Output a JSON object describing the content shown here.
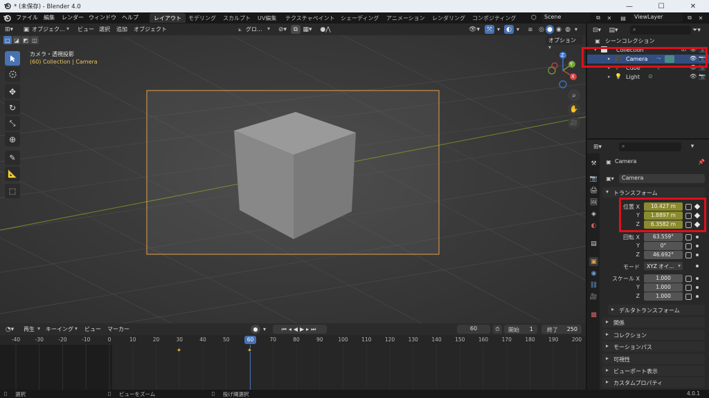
{
  "window": {
    "title": "* (未保存) - Blender 4.0"
  },
  "menubar": {
    "items": [
      "ファイル",
      "編集",
      "レンダー",
      "ウィンドウ",
      "ヘルプ"
    ],
    "workspaces": [
      "レイアウト",
      "モデリング",
      "スカルプト",
      "UV編集",
      "テクスチャペイント",
      "シェーディング",
      "アニメーション",
      "レンダリング",
      "コンポジティング"
    ],
    "active_workspace": "レイアウト",
    "scene": "Scene",
    "view_layer": "ViewLayer"
  },
  "viewport": {
    "header": {
      "mode": "オブジェク...",
      "view": "ビュー",
      "select": "選択",
      "add": "追加",
      "object": "オブジェクト",
      "transform_orientation": "グロ...",
      "options": "オプション"
    },
    "overlay_title": "カメラ・透視投影",
    "overlay_context": "(60) Collection | Camera",
    "gizmo_axes": [
      "X",
      "Y",
      "Z"
    ]
  },
  "timeline": {
    "header": {
      "playback": "再生",
      "keying": "キーイング",
      "view": "ビュー",
      "marker": "マーカー"
    },
    "current_frame": "60",
    "start_label": "開始",
    "start": "1",
    "end_label": "終了",
    "end": "250",
    "ruler": [
      "-40",
      "-30",
      "-20",
      "-10",
      "0",
      "10",
      "20",
      "30",
      "40",
      "50",
      "60",
      "70",
      "80",
      "90",
      "100",
      "110",
      "120",
      "130",
      "140",
      "150",
      "160",
      "170",
      "180",
      "190",
      "200"
    ],
    "keyframes": [
      30,
      60
    ]
  },
  "statusbar": {
    "select": "選択",
    "zoom": "ビューをズーム",
    "lasso": "投げ縄選択",
    "version": "4.0.1"
  },
  "outliner": {
    "scene_collection": "シーンコレクション",
    "rows": [
      {
        "name": "Collection",
        "selected": false
      },
      {
        "name": "Camera",
        "selected": true
      },
      {
        "name": "Cube",
        "selected": false
      },
      {
        "name": "Light",
        "selected": false
      }
    ]
  },
  "properties": {
    "object_name": "Camera",
    "object_name_field": "Camera",
    "transform_header": "トランスフォーム",
    "location_label": "位置 X",
    "rotation_label": "回転 X",
    "scale_label": "スケール X",
    "location": [
      "10.427 m",
      "1.8897 m",
      "6.3582 m"
    ],
    "rotation": [
      "63.559°",
      "0°",
      "46.692°"
    ],
    "mode_label": "モード",
    "mode": "XYZ オイ...",
    "scale": [
      "1.000",
      "1.000",
      "1.000"
    ],
    "axis_y": "Y",
    "axis_z": "Z",
    "delta": "デルタトランスフォーム",
    "sections": [
      "関係",
      "コレクション",
      "モーションパス",
      "可視性",
      "ビューポート表示",
      "カスタムプロパティ"
    ]
  },
  "colors": {
    "accent": "#4772b3",
    "highlight_box": "#e0101c",
    "camera_frame": "#e8a04a",
    "keyed_field": "#8a8a2e"
  }
}
